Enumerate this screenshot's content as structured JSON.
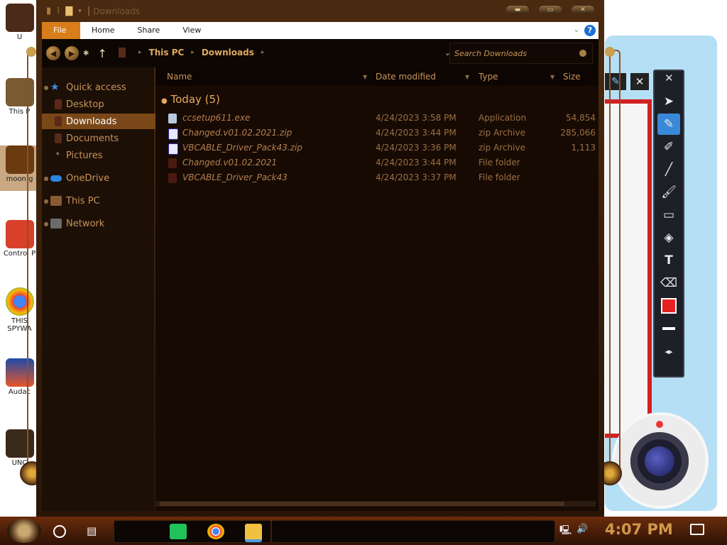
{
  "window": {
    "title": "Downloads",
    "controls": {
      "minimize": "▬",
      "maximize": "▭",
      "close": "✕"
    }
  },
  "ribbon": {
    "tabs": [
      "File",
      "Home",
      "Share",
      "View"
    ],
    "help": "?"
  },
  "navigation": {
    "breadcrumb": [
      "This PC",
      "Downloads"
    ],
    "search_placeholder": "Search Downloads"
  },
  "sidebar": {
    "items": [
      {
        "label": "Quick access",
        "icon": "star-icon",
        "pinned": false
      },
      {
        "label": "Desktop",
        "icon": "desktop-folder-icon",
        "pinned": true
      },
      {
        "label": "Downloads",
        "icon": "downloads-folder-icon",
        "pinned": true,
        "selected": true
      },
      {
        "label": "Documents",
        "icon": "documents-folder-icon",
        "pinned": true
      },
      {
        "label": "Pictures",
        "icon": "pictures-folder-icon",
        "pinned": true
      },
      {
        "label": "OneDrive",
        "icon": "cloud-icon",
        "pinned": false
      },
      {
        "label": "This PC",
        "icon": "computer-icon",
        "pinned": false
      },
      {
        "label": "Network",
        "icon": "network-icon",
        "pinned": false
      }
    ]
  },
  "columns": {
    "name": "Name",
    "date": "Date modified",
    "type": "Type",
    "size": "Size"
  },
  "group": {
    "label": "Today (5)"
  },
  "files": [
    {
      "name": "ccsetup611.exe",
      "date": "4/24/2023 3:58 PM",
      "type": "Application",
      "size": "54,854",
      "icon": "installer-icon"
    },
    {
      "name": "Changed.v01.02.2021.zip",
      "date": "4/24/2023 3:44 PM",
      "type": "zip Archive",
      "size": "285,066",
      "icon": "zip-icon"
    },
    {
      "name": "VBCABLE_Driver_Pack43.zip",
      "date": "4/24/2023 3:36 PM",
      "type": "zip Archive",
      "size": "1,113",
      "icon": "zip-icon"
    },
    {
      "name": "Changed.v01.02.2021",
      "date": "4/24/2023 3:44 PM",
      "type": "File folder",
      "size": "",
      "icon": "folder-icon"
    },
    {
      "name": "VBCABLE_Driver_Pack43",
      "date": "4/24/2023 3:37 PM",
      "type": "File folder",
      "size": "",
      "icon": "folder-icon"
    }
  ],
  "desktop_icons": [
    {
      "label": "U"
    },
    {
      "label": "This P"
    },
    {
      "label": "moon g"
    },
    {
      "label": "Control P"
    },
    {
      "label": "THIS SPYWA"
    },
    {
      "label": "Audac"
    },
    {
      "label": "UNC"
    }
  ],
  "draw_tools": [
    "pointer",
    "pen",
    "marker",
    "line",
    "brush",
    "rectangle",
    "fill",
    "text",
    "eraser",
    "color",
    "stroke",
    "collapse"
  ],
  "taskbar": {
    "time": "4:07 PM"
  },
  "colors": {
    "accent": "#d77d19",
    "brand_brown": "#7a4818",
    "text_copper": "#c8935a"
  }
}
